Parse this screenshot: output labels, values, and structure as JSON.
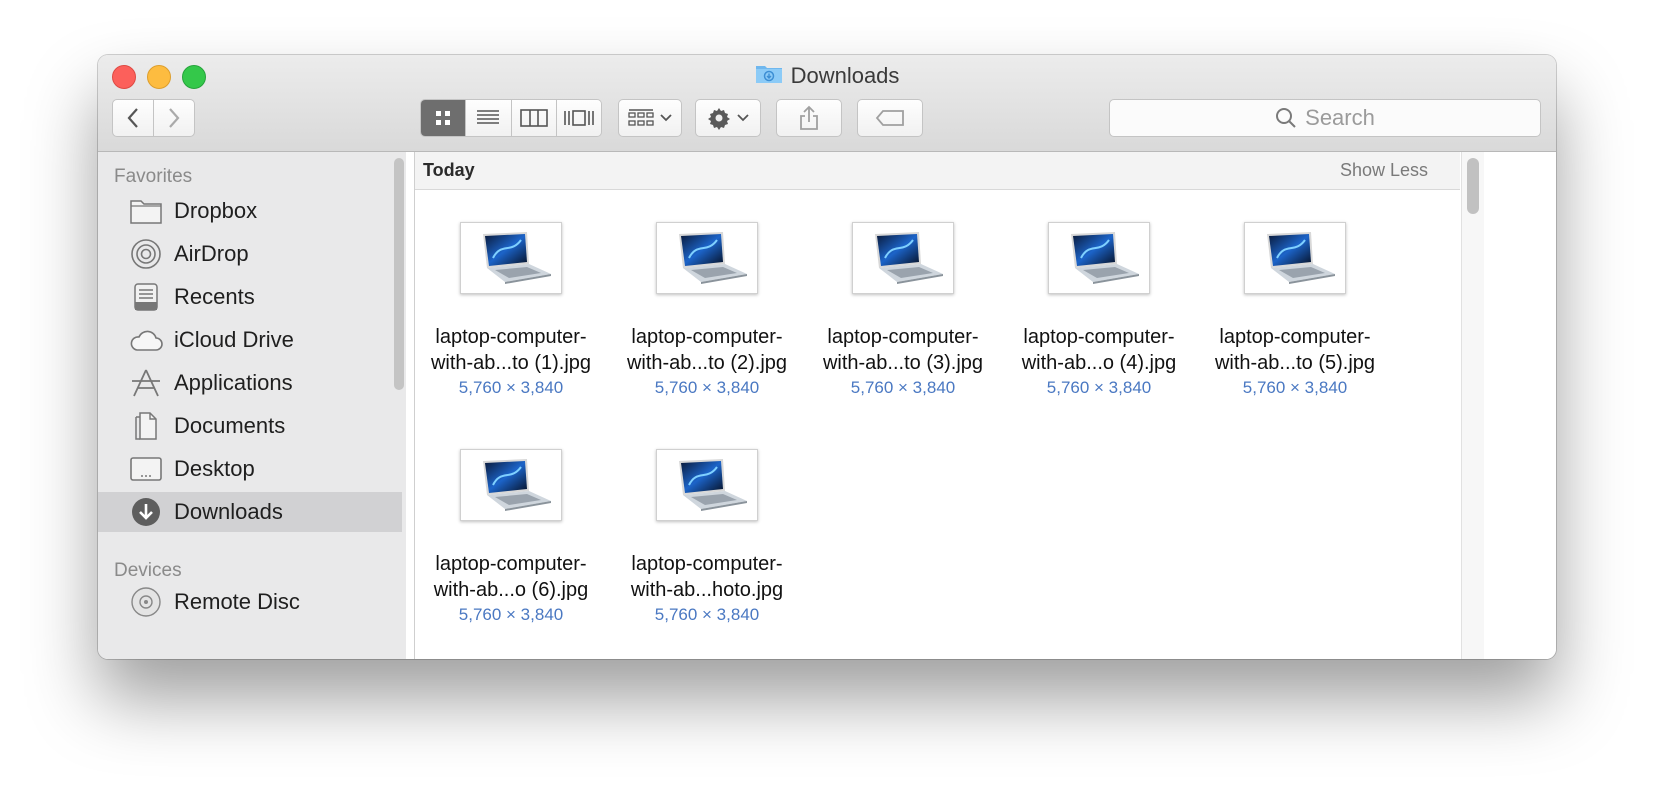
{
  "window": {
    "title": "Downloads"
  },
  "toolbar": {
    "back_icon": "chevron-left-icon",
    "forward_icon": "chevron-right-icon",
    "view_modes": [
      "icon-view",
      "list-view",
      "column-view",
      "cover-flow-view"
    ],
    "active_view": "icon-view",
    "search_placeholder": "Search"
  },
  "sidebar": {
    "favorites_heading": "Favorites",
    "favorites": [
      {
        "label": "Dropbox",
        "icon": "folder-icon"
      },
      {
        "label": "AirDrop",
        "icon": "airdrop-icon"
      },
      {
        "label": "Recents",
        "icon": "recents-icon"
      },
      {
        "label": "iCloud Drive",
        "icon": "cloud-icon"
      },
      {
        "label": "Applications",
        "icon": "applications-icon"
      },
      {
        "label": "Documents",
        "icon": "documents-icon"
      },
      {
        "label": "Desktop",
        "icon": "desktop-icon"
      },
      {
        "label": "Downloads",
        "icon": "download-icon",
        "selected": true
      }
    ],
    "devices_heading": "Devices",
    "devices": [
      {
        "label": "Remote Disc",
        "icon": "disc-icon"
      }
    ]
  },
  "content": {
    "group_title": "Today",
    "show_less": "Show Less",
    "files": [
      {
        "line1": "laptop-computer-",
        "line2": "with-ab...to (1).jpg",
        "dims": "5,760 × 3,840"
      },
      {
        "line1": "laptop-computer-",
        "line2": "with-ab...to (2).jpg",
        "dims": "5,760 × 3,840"
      },
      {
        "line1": "laptop-computer-",
        "line2": "with-ab...to (3).jpg",
        "dims": "5,760 × 3,840"
      },
      {
        "line1": "laptop-computer-",
        "line2": "with-ab...o (4).jpg",
        "dims": "5,760 × 3,840"
      },
      {
        "line1": "laptop-computer-",
        "line2": "with-ab...to (5).jpg",
        "dims": "5,760 × 3,840"
      },
      {
        "line1": "laptop-computer-",
        "line2": "with-ab...o (6).jpg",
        "dims": "5,760 × 3,840"
      },
      {
        "line1": "laptop-computer-",
        "line2": "with-ab...hoto.jpg",
        "dims": "5,760 × 3,840"
      }
    ]
  }
}
